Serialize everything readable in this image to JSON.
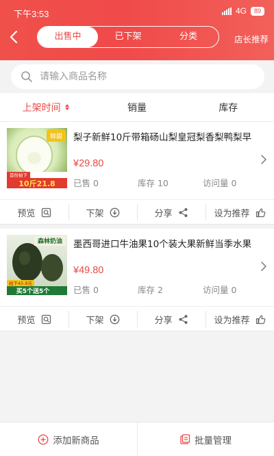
{
  "status": {
    "time": "下午3:53",
    "network": "4G",
    "battery": "89"
  },
  "header": {
    "tabs": [
      {
        "label": "出售中"
      },
      {
        "label": "已下架"
      },
      {
        "label": "分类"
      }
    ],
    "recommend_label": "店长推荐"
  },
  "search": {
    "placeholder": "请输入商品名称",
    "value": ""
  },
  "sort": {
    "items": [
      {
        "label": "上架时间"
      },
      {
        "label": "销量"
      },
      {
        "label": "库存"
      }
    ]
  },
  "products": [
    {
      "title": "梨子新鲜10斤带箱砀山梨皇冠梨香梨鸭梨早",
      "price": "¥29.80",
      "sold": "已售 0",
      "stock": "库存 10",
      "views": "访问量 0",
      "thumb": {
        "badge_top": "鲜甜",
        "promo_small": "首份拍下",
        "promo_big": "10斤21.8"
      }
    },
    {
      "title": "墨西哥进口牛油果10个装大果新鲜当季水果",
      "price": "¥49.80",
      "sold": "已售 0",
      "stock": "库存 2",
      "views": "访问量 0",
      "thumb": {
        "badge_top": "森林奶油",
        "promo_small": "拍下45.8元",
        "promo_big": "买5个送5个"
      }
    }
  ],
  "actions": {
    "preview": "预览",
    "unlist": "下架",
    "share": "分享",
    "recommend": "设为推荐"
  },
  "bottom": {
    "add": "添加新商品",
    "batch": "批量管理"
  },
  "colors": {
    "accent": "#e84a46",
    "header_start": "#f0504a",
    "header_end": "#f2605a"
  }
}
